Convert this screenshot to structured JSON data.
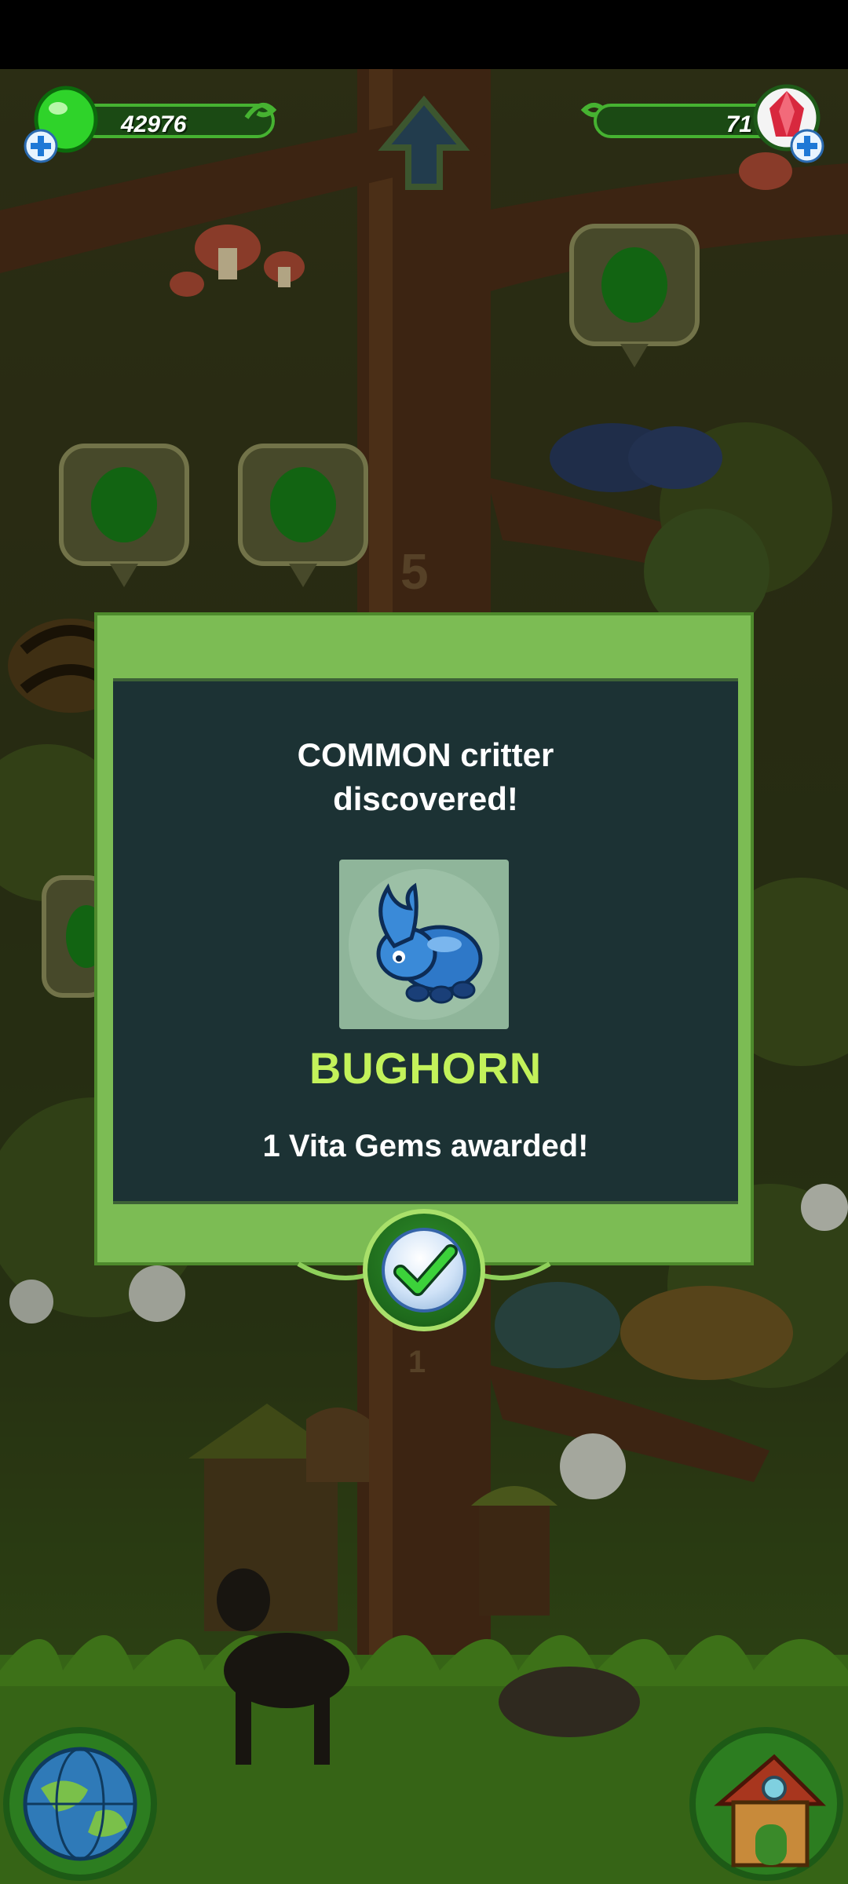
{
  "hud": {
    "slime_count": "42976",
    "gem_count": "71"
  },
  "map": {
    "level_marker": "5",
    "level_marker_lower": "1"
  },
  "modal": {
    "headline_line1": "COMMON critter",
    "headline_line2": "discovered!",
    "critter_name": "BUGHORN",
    "award_text": "1 Vita Gems awarded!"
  },
  "icons": {
    "slime": "green-slime-icon",
    "gem": "red-crystal-gem-icon",
    "confirm": "checkmark-icon",
    "world": "globe-icon",
    "home": "house-icon",
    "up": "up-arrow-icon"
  },
  "colors": {
    "modal_frame": "#7cbc54",
    "modal_panel": "#1c3234",
    "critter_name": "#c3f25a",
    "hud_bar": "#1b4a14"
  }
}
